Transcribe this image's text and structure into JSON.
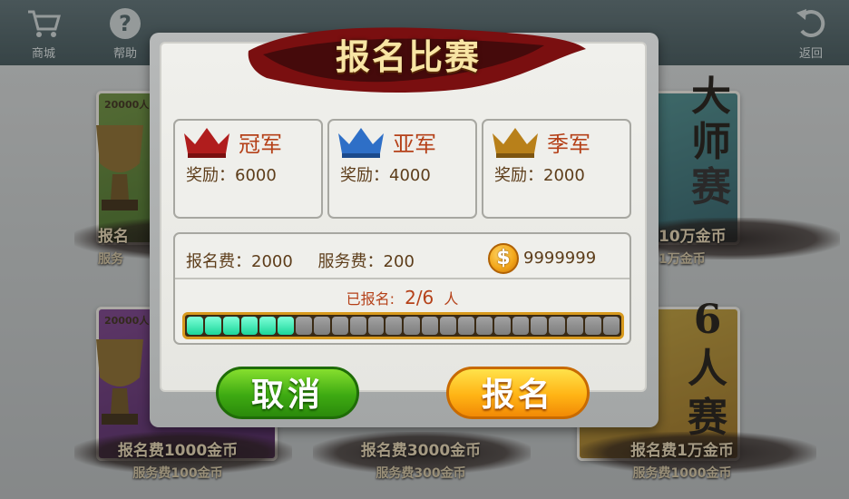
{
  "top_nav": {
    "shop_label": "商城",
    "help_label": "帮助",
    "back_label": "返回"
  },
  "background_cards": [
    {
      "count": "20000人",
      "fee": "报名",
      "service": "服务"
    },
    {
      "count": "20000人",
      "fee": "报名费1000金币",
      "service": "服务费100金币"
    },
    {
      "fee": "报名费3000金币",
      "service": "服务费300金币"
    },
    {
      "fee": "10万金币",
      "service": "1万金币",
      "calligraphy": [
        "大",
        "师",
        "赛"
      ]
    },
    {
      "fee": "报名费1万金币",
      "service": "服务费1000金币",
      "calligraphy": [
        "6",
        "人",
        "赛"
      ]
    }
  ],
  "dialog": {
    "title": "报名比赛",
    "prizes": [
      {
        "rank": "冠军",
        "reward": "奖励：6000",
        "crown_color": "#b01d1d"
      },
      {
        "rank": "亚军",
        "reward": "奖励：4000",
        "crown_color": "#2e6fc7"
      },
      {
        "rank": "季军",
        "reward": "奖励：2000",
        "crown_color": "#b8801a"
      }
    ],
    "entry_fee": "报名费：2000",
    "service_fee": "服务费：200",
    "coin_icon": "coin-icon",
    "coin_symbol": "$",
    "coins": "9999999",
    "enrolled_prefix": "已报名:",
    "enrolled_count": "2/6",
    "enrolled_suffix": "人",
    "progress": {
      "filled": 6,
      "total": 24
    },
    "cancel_label": "取消",
    "signup_label": "报名"
  },
  "colors": {
    "accent_red": "#b54119",
    "progress_on": "#1bd69a",
    "progress_frame": "#d89a1e",
    "cancel_green": "#3eaa12",
    "signup_orange": "#ffb415"
  }
}
